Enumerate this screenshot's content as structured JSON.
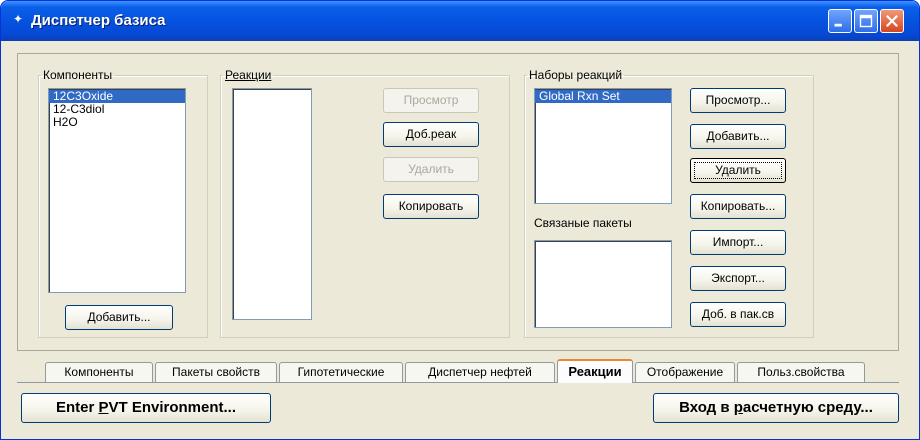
{
  "window": {
    "title": "Диспетчер базиса",
    "minimize_label": "",
    "maximize_label": "",
    "close_label": ""
  },
  "components": {
    "group_label": "Компоненты",
    "items": [
      "12C3Oxide",
      "12-C3diol",
      "H2O"
    ],
    "selected_index": 0,
    "add_button": "Добавить..."
  },
  "reactions": {
    "group_label": "Реакции",
    "buttons": {
      "view": "Просмотр",
      "add_reaction": "Доб.реак",
      "delete": "Удалить",
      "copy": "Копировать"
    }
  },
  "reaction_sets": {
    "group_label": "Наборы реакций",
    "items": [
      "Global Rxn Set"
    ],
    "selected_index": 0,
    "linked_packages_label": "Связаные пакеты",
    "buttons": {
      "view": "Просмотр...",
      "add": "Добавить...",
      "delete": "Удалить",
      "copy": "Копировать...",
      "import": "Импорт...",
      "export": "Экспорт...",
      "add_to_package": "Доб. в пак.св"
    }
  },
  "tabs": [
    {
      "label": "Компоненты",
      "active": false
    },
    {
      "label": "Пакеты свойств",
      "active": false
    },
    {
      "label": "Гипотетические",
      "active": false
    },
    {
      "label": "Диспетчер нефтей",
      "active": false
    },
    {
      "label": "Реакции",
      "active": true
    },
    {
      "label": "Отображение",
      "active": false
    },
    {
      "label": "Польз.свойства",
      "active": false
    }
  ],
  "footer": {
    "enter_pvt_prefix": "Enter ",
    "enter_pvt_accel": "P",
    "enter_pvt_suffix": "VT Environment...",
    "enter_sim_prefix": "Вход в ",
    "enter_sim_accel": "р",
    "enter_sim_suffix": "асчетную среду..."
  },
  "colors": {
    "titlebar": "#0553e0",
    "selection": "#316ac5",
    "window_bg": "#ece9d8",
    "active_tab_accent": "#e68b2c"
  }
}
